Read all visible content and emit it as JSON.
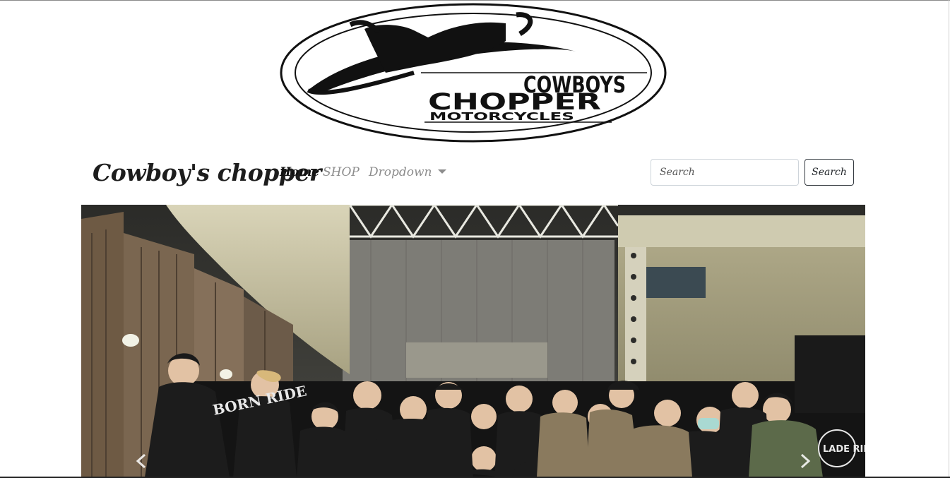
{
  "logo": {
    "line1": "COWBOYS",
    "line2": "CHOPPER",
    "line3": "MOTORCYCLES"
  },
  "navbar": {
    "brand": "Cowboy's chopper",
    "items": [
      {
        "label": "Home",
        "active": true
      },
      {
        "label": "SHOP",
        "active": false
      },
      {
        "label": "Dropdown",
        "active": false
      }
    ]
  },
  "search": {
    "placeholder": "Search",
    "button_label": "Search"
  },
  "carousel": {
    "image": "group-photo",
    "prev_icon": "chevron-left-icon",
    "next_icon": "chevron-right-icon"
  },
  "colors": {
    "brand_text": "#1d1d1d",
    "nav_muted": "#8c8c8c",
    "button_border": "#343a40"
  }
}
